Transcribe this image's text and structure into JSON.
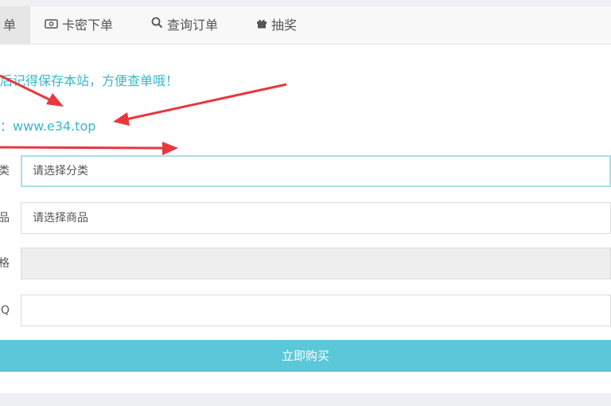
{
  "tabs": [
    {
      "label": "单",
      "icon": "",
      "active": true
    },
    {
      "label": "卡密下单",
      "icon": "card-icon",
      "active": false
    },
    {
      "label": "查询订单",
      "icon": "search-icon",
      "active": false
    },
    {
      "label": "抽奖",
      "icon": "gift-icon",
      "active": false
    }
  ],
  "notice": {
    "line1": "后记得保存本站，方便查单哦！",
    "line2": "：www.e34.top"
  },
  "form": {
    "category": {
      "label": "类",
      "value": "请选择分类"
    },
    "product": {
      "label": "品",
      "value": "请选择商品"
    },
    "price": {
      "label": "格",
      "value": ""
    },
    "qq": {
      "label": "Q",
      "value": ""
    }
  },
  "buy_button_label": "立即购买",
  "colors": {
    "accent": "#5bc8d9",
    "notice_text": "#38b7c9",
    "arrow": "#e8383d"
  }
}
